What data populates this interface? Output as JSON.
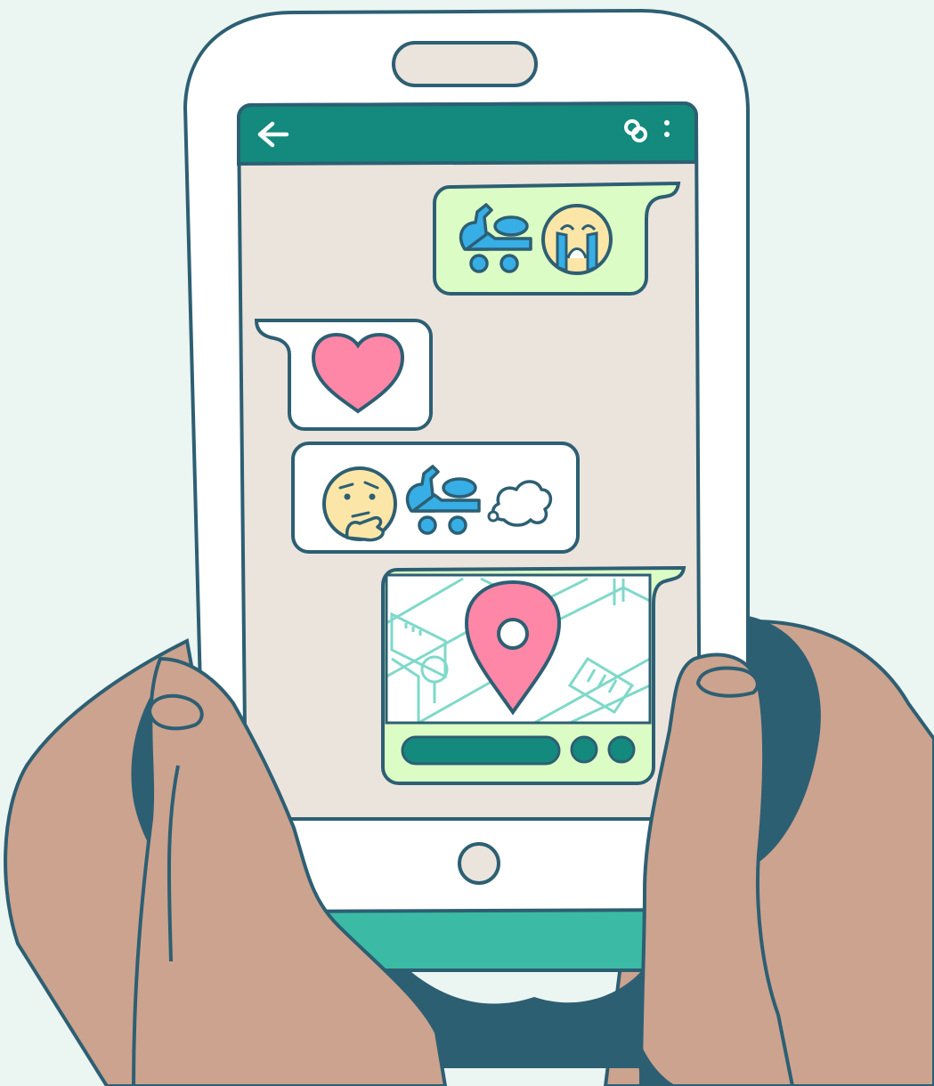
{
  "colors": {
    "background": "#ebf5f1",
    "outline": "#2d5f73",
    "phone_body": "#ffffff",
    "screen": "#ebe4dd",
    "header": "#138a7d",
    "phone_base": "#3bbba5",
    "skin": "#cca38e",
    "sent_bubble": "#dcfcc6",
    "received_bubble": "#ffffff",
    "heart": "#fe87a8",
    "scooter": "#37aee6",
    "emoji_face": "#fbe6a8",
    "map_lines": "#7fd9c9"
  },
  "header": {
    "back_icon": "arrow-left-icon",
    "link_icon": "link-icon",
    "menu_icon": "more-vertical-icon"
  },
  "messages": [
    {
      "direction": "sent",
      "content": [
        "scooter-icon",
        "crying-face-icon"
      ]
    },
    {
      "direction": "received",
      "content": [
        "heart-icon"
      ]
    },
    {
      "direction": "received",
      "content": [
        "thinking-face-icon",
        "scooter-icon",
        "cloud-icon"
      ]
    },
    {
      "direction": "sent",
      "content": [
        "map-location-pin"
      ]
    }
  ],
  "home_button_icon": "home-button-icon"
}
